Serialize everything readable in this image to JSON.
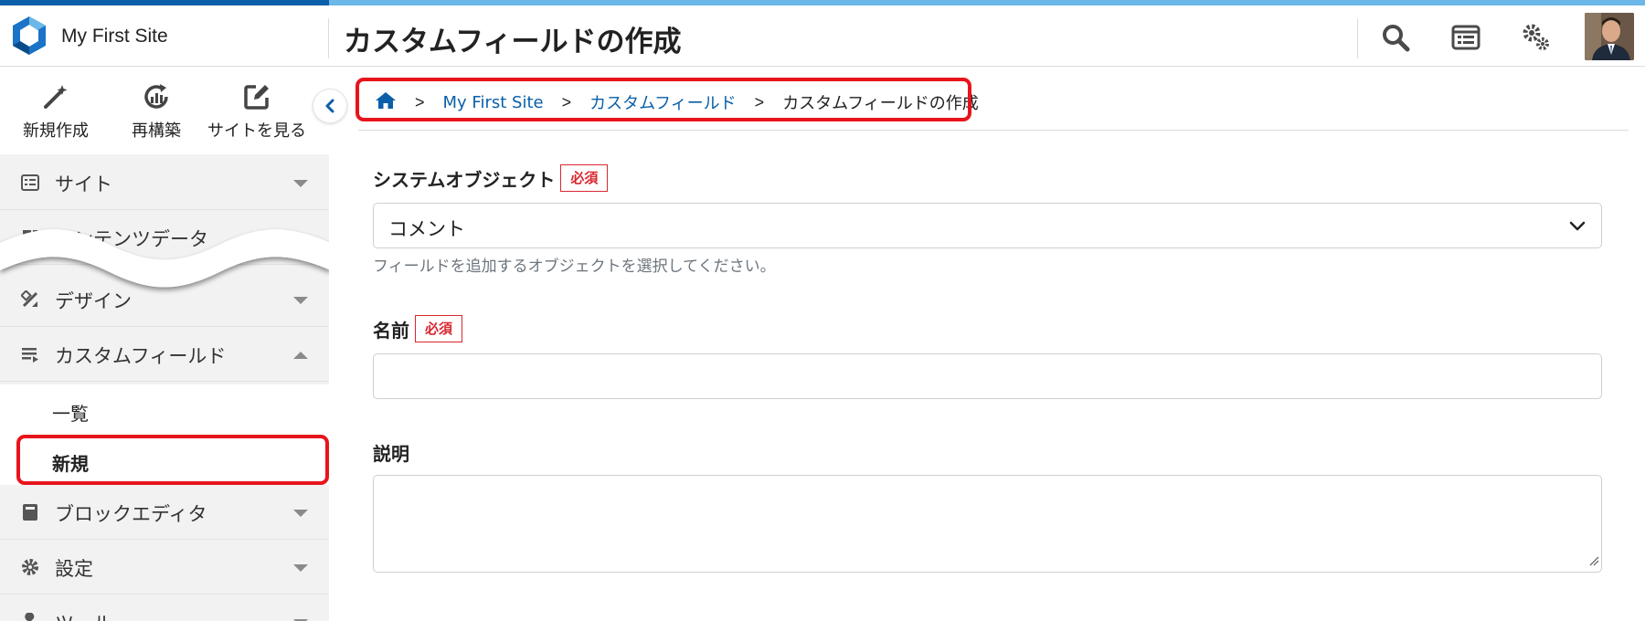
{
  "header": {
    "site_name": "My First Site",
    "page_title": "カスタムフィールドの作成",
    "icons": [
      "search-icon",
      "list-window-icon",
      "gears-icon"
    ]
  },
  "quick_actions": [
    {
      "label": "新規作成",
      "icon": "magic-wand-icon"
    },
    {
      "label": "再構築",
      "icon": "rebuild-icon"
    },
    {
      "label": "サイトを見る",
      "icon": "external-edit-icon"
    }
  ],
  "sidebar": {
    "items": [
      {
        "label": "サイト",
        "icon": "site-list-icon"
      },
      {
        "label": "コンテンツデータ",
        "icon": "content-data-icon"
      },
      {
        "label": "デザイン",
        "icon": "design-tools-icon"
      },
      {
        "label": "カスタムフィールド",
        "icon": "custom-field-icon"
      },
      {
        "label": "ブロックエディタ",
        "icon": "block-editor-icon"
      },
      {
        "label": "設定",
        "icon": "gear-icon"
      },
      {
        "label": "ツール",
        "icon": "wrench-icon"
      }
    ],
    "custom_field_sub": [
      {
        "label": "一覧"
      },
      {
        "label": "新規"
      }
    ]
  },
  "breadcrumb": {
    "items": [
      "My First Site",
      "カスタムフィールド",
      "カスタムフィールドの作成"
    ],
    "separator": ">"
  },
  "form": {
    "system_object": {
      "label": "システムオブジェクト",
      "required": "必須",
      "value": "コメント",
      "hint": "フィールドを追加するオブジェクトを選択してください。"
    },
    "name": {
      "label": "名前",
      "required": "必須",
      "value": ""
    },
    "description": {
      "label": "説明",
      "value": ""
    }
  },
  "colors": {
    "brand_dark": "#0a5fa8",
    "brand_light": "#6bb7e8",
    "highlight": "#e8141c",
    "required": "#d9272e"
  }
}
